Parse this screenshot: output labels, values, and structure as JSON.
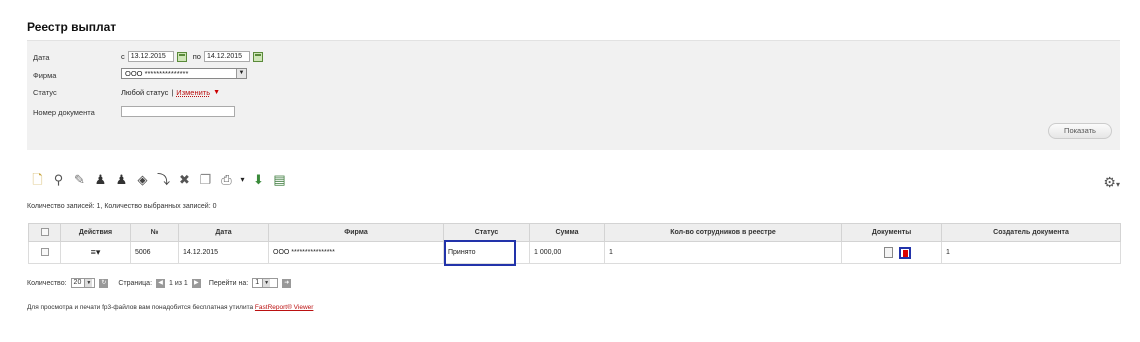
{
  "page_title": "Реестр выплат",
  "filters": {
    "date_label": "Дата",
    "date_from_prefix": "с",
    "date_from": "13.12.2015",
    "date_to_prefix": "по",
    "date_to": "14.12.2015",
    "firm_label": "Фирма",
    "firm_value": "ООО ***************",
    "status_label": "Статус",
    "status_value": "Любой статус",
    "status_separator": "|",
    "status_change_link": "Изменить",
    "docnum_label": "Номер документа",
    "docnum_value": "",
    "show_button": "Показать"
  },
  "toolbar": {
    "icons": [
      "new-document-icon",
      "search-icon",
      "edit-icon",
      "user-approve-icon",
      "user-reject-icon",
      "tag-icon",
      "send-icon",
      "delete-icon",
      "copy-icon",
      "print-icon",
      "export-icon",
      "report-icon"
    ],
    "settings_icon": "gear-icon"
  },
  "records_info": "Количество записей: 1, Количество выбранных записей: 0",
  "table": {
    "columns": [
      "",
      "Действия",
      "№",
      "Дата",
      "Фирма",
      "Статус",
      "Сумма",
      "Кол-во сотрудников в реестре",
      "Документы",
      "Создатель документа"
    ],
    "rows": [
      {
        "number": "5006",
        "date": "14.12.2015",
        "firm": "ООО ****************",
        "status": "Принято",
        "sum": "1 000,00",
        "employees": "1",
        "creator": "1"
      }
    ]
  },
  "pager": {
    "count_label": "Количество:",
    "count_value": "20",
    "page_label": "Страница:",
    "page_text": "1 из 1",
    "goto_label": "Перейти на:",
    "goto_value": "1"
  },
  "footer": {
    "text": "Для просмотра и печати fp3-файлов вам понадобится бесплатная утилита",
    "link": "FastReport® Viewer"
  },
  "colors": {
    "highlight": "#2233aa",
    "link": "#bb1111"
  }
}
